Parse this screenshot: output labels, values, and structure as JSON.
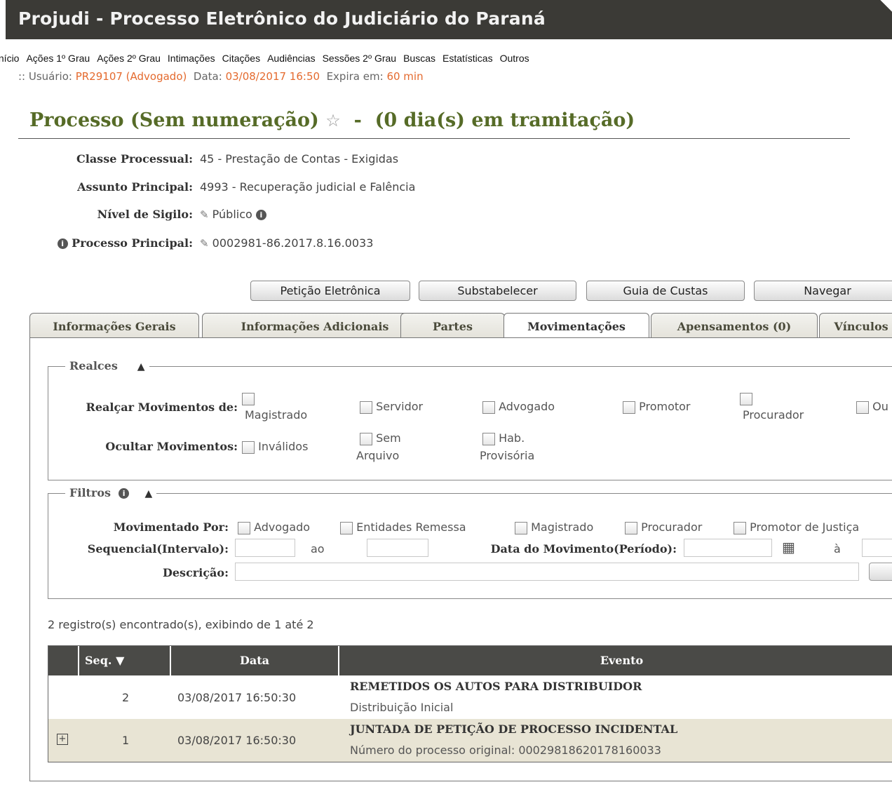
{
  "app": {
    "title": "Projudi - Processo Eletrônico do Judiciário do Paraná"
  },
  "menu": [
    "Início",
    "Ações 1º Grau",
    "Ações 2º Grau",
    "Intimações",
    "Citações",
    "Audiências",
    "Sessões 2º Grau",
    "Buscas",
    "Estatísticas",
    "Outros"
  ],
  "user": {
    "prefix": ":: Usuário:",
    "id": "PR29107 (Advogado)",
    "date_label": "Data:",
    "date": "03/08/2017 16:50",
    "expira_label": "Expira em:",
    "expira": "60 min"
  },
  "process": {
    "title": "Processo (Sem numeração)",
    "sep": "-",
    "days": "(0 dia(s) em tramitação)",
    "fields": {
      "classe_label": "Classe Processual:",
      "classe_value": "45 - Prestação de Contas - Exigidas",
      "assunto_label": "Assunto Principal:",
      "assunto_value": "4993 - Recuperação judicial e Falência",
      "sigilo_label": "Nível de Sigilo:",
      "sigilo_value": "Público",
      "principal_label": "Processo Principal:",
      "principal_value": "0002981-86.2017.8.16.0033"
    }
  },
  "actions": [
    "Petição Eletrônica",
    "Substabelecer",
    "Guia de Custas",
    "Navegar"
  ],
  "tabs": [
    "Informações Gerais",
    "Informações Adicionais",
    "Partes",
    "Movimentações",
    "Apensamentos (0)",
    "Vínculos"
  ],
  "realces": {
    "legend": "Realces",
    "realcar_label": "Realçar Movimentos de:",
    "realcar_opts": [
      "Magistrado",
      "Servidor",
      "Advogado",
      "Promotor",
      "Procurador",
      "Ou"
    ],
    "ocultar_label": "Ocultar Movimentos:",
    "ocultar_opts": [
      "Inválidos",
      "Sem",
      "Arquivo",
      "Hab.",
      "Provisória"
    ]
  },
  "filtros": {
    "legend": "Filtros",
    "mov_por_label": "Movimentado Por:",
    "mov_por_opts": [
      "Advogado",
      "Entidades Remessa",
      "Magistrado",
      "Procurador",
      "Promotor de Justiça"
    ],
    "seq_label": "Sequencial(Intervalo):",
    "ao": "ao",
    "data_label": "Data do Movimento(Período):",
    "a": "à",
    "descricao_label": "Descrição:"
  },
  "records_text": "2 registro(s) encontrado(s), exibindo de 1 até 2",
  "table": {
    "headers": [
      "Seq. ▼",
      "Data",
      "Evento"
    ],
    "rows": [
      {
        "seq": "2",
        "date": "03/08/2017 16:50:30",
        "title": "REMETIDOS OS AUTOS PARA DISTRIBUIDOR",
        "sub": "Distribuição Inicial"
      },
      {
        "seq": "1",
        "date": "03/08/2017 16:50:30",
        "title": "JUNTADA DE PETIÇÃO DE PROCESSO INCIDENTAL",
        "sub": "Número do processo original: 00029818620178160033"
      }
    ]
  },
  "colors": {
    "header_bg": "#3b3a36",
    "title_green": "#566b27",
    "highlight": "#e46a2e",
    "row_alt": "#e8e4d4"
  }
}
